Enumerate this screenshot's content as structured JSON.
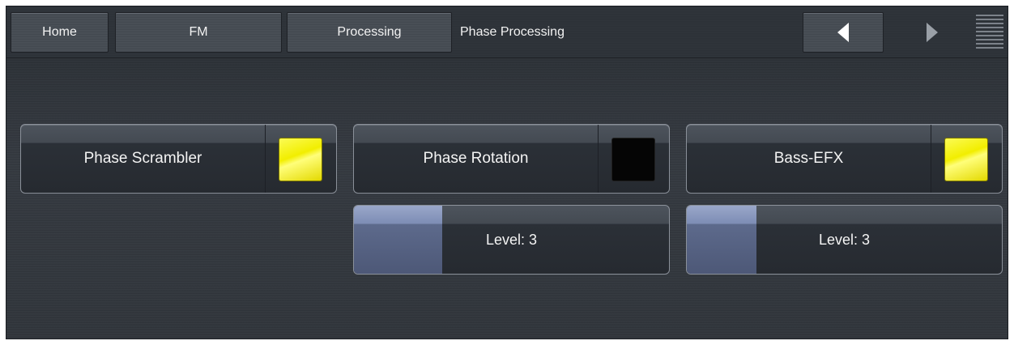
{
  "nav": {
    "home": "Home",
    "fm": "FM",
    "processing": "Processing",
    "current": "Phase Processing"
  },
  "controls": {
    "phase_scrambler": {
      "label": "Phase Scrambler",
      "state": "on"
    },
    "phase_rotation": {
      "label": "Phase Rotation",
      "state": "off"
    },
    "bass_efx": {
      "label": "Bass-EFX",
      "state": "on"
    },
    "phase_rotation_level": {
      "label": "Level: 3",
      "value": 3,
      "fill_fraction": 0.28
    },
    "bass_efx_level": {
      "label": "Level: 3",
      "value": 3,
      "fill_fraction": 0.22
    }
  },
  "icons": {
    "back": "left-arrow-icon",
    "forward": "right-arrow-icon",
    "menu": "menu-icon"
  },
  "colors": {
    "led_on": "#f2ee00",
    "led_off": "#050505",
    "slider_fill": "#7d8db5"
  }
}
